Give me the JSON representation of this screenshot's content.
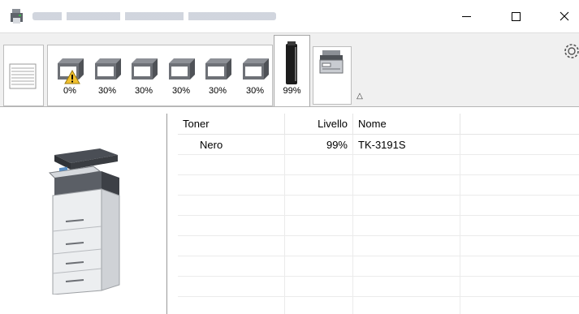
{
  "window": {
    "title_obscured": true,
    "controls": [
      "minimize",
      "maximize",
      "close"
    ]
  },
  "toolbar": {
    "trays": [
      {
        "percent": "0%",
        "warning": true
      },
      {
        "percent": "30%",
        "warning": false
      },
      {
        "percent": "30%",
        "warning": false
      },
      {
        "percent": "30%",
        "warning": false
      },
      {
        "percent": "30%",
        "warning": false
      },
      {
        "percent": "30%",
        "warning": false
      }
    ],
    "toner_tab_percent": "99%",
    "collapse_glyph": "△"
  },
  "table": {
    "headers": {
      "toner": "Toner",
      "livello": "Livello",
      "nome": "Nome"
    },
    "rows": [
      {
        "toner": "Nero",
        "livello": "99%",
        "nome": "TK-3191S"
      }
    ],
    "empty_rows": 8
  },
  "icons": {
    "app": "printer-app-icon",
    "tray_list": "paper-stack-icon",
    "toner": "toner-cartridge-icon",
    "device": "mfp-device-icon",
    "settings": "gear-icon",
    "warning": "warning-triangle-icon"
  },
  "colors": {
    "toolbar_bg": "#f0f0f0",
    "warning": "#f2c12e",
    "tray_gray": "#6e7177"
  }
}
